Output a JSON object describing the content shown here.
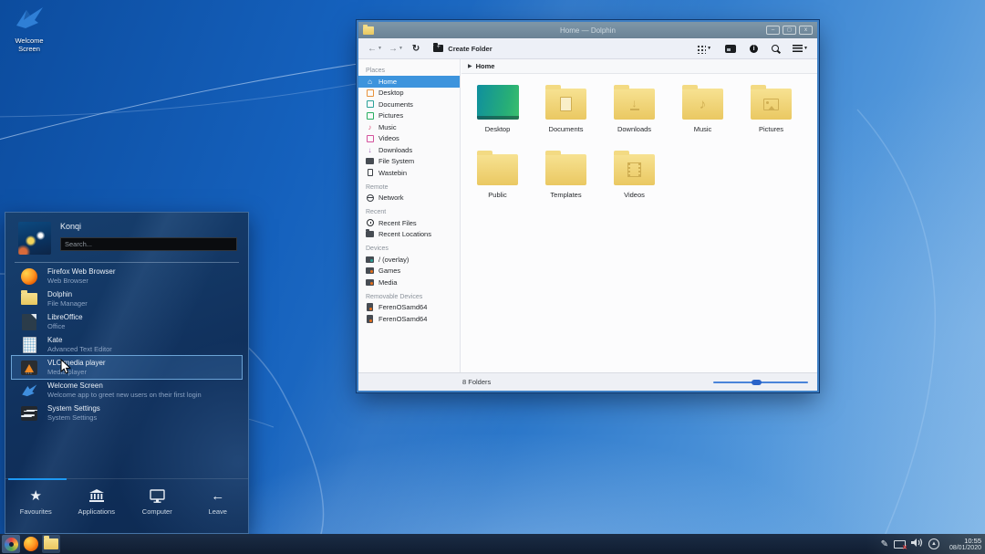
{
  "colors": {
    "accent": "#1d99f3",
    "selection": "#3d94dd",
    "folder": "#eac862",
    "menu_bg": "#10305c",
    "taskbar_bg": "#101d31",
    "titlebar": "#6a8295"
  },
  "desktop": {
    "icon_label": "Welcome\nScreen",
    "icon_label_line1": "Welcome",
    "icon_label_line2": "Screen"
  },
  "window": {
    "title": "Home — Dolphin",
    "buttons": {
      "minimize": "–",
      "maximize": "◻",
      "close": "x"
    },
    "toolbar": {
      "back": "←",
      "forward": "→",
      "refresh": "↻",
      "create_folder_label": "Create Folder"
    },
    "breadcrumb": {
      "caret": "▶",
      "root_label": "Home"
    },
    "places": {
      "sections": [
        {
          "title": "Places",
          "items": [
            {
              "label": "Home"
            },
            {
              "label": "Desktop"
            },
            {
              "label": "Documents"
            },
            {
              "label": "Pictures"
            },
            {
              "label": "Music"
            },
            {
              "label": "Videos"
            },
            {
              "label": "Downloads"
            },
            {
              "label": "File System"
            },
            {
              "label": "Wastebin"
            }
          ]
        },
        {
          "title": "Remote",
          "items": [
            {
              "label": "Network"
            }
          ]
        },
        {
          "title": "Recent",
          "items": [
            {
              "label": "Recent Files"
            },
            {
              "label": "Recent Locations"
            }
          ]
        },
        {
          "title": "Devices",
          "items": [
            {
              "label": "/ (overlay)"
            },
            {
              "label": "Games"
            },
            {
              "label": "Media"
            }
          ]
        },
        {
          "title": "Removable Devices",
          "items": [
            {
              "label": "FerenOSamd64"
            },
            {
              "label": "FerenOSamd64"
            }
          ]
        }
      ]
    },
    "files": [
      {
        "name": "Desktop"
      },
      {
        "name": "Documents"
      },
      {
        "name": "Downloads"
      },
      {
        "name": "Music"
      },
      {
        "name": "Pictures"
      },
      {
        "name": "Public"
      },
      {
        "name": "Templates"
      },
      {
        "name": "Videos"
      }
    ],
    "statusbar": {
      "text": "8 Folders"
    }
  },
  "menu": {
    "user": "Konqi",
    "search_placeholder": "Search...",
    "apps": [
      {
        "name": "Firefox Web Browser",
        "desc": "Web Browser"
      },
      {
        "name": "Dolphin",
        "desc": "File Manager"
      },
      {
        "name": "LibreOffice",
        "desc": "Office"
      },
      {
        "name": "Kate",
        "desc": "Advanced Text Editor"
      },
      {
        "name": "VLC media player",
        "desc": "Media player"
      },
      {
        "name": "Welcome Screen",
        "desc": "Welcome app to greet new users on their first login"
      },
      {
        "name": "System Settings",
        "desc": "System Settings"
      }
    ],
    "tabs": [
      {
        "label": "Favourites",
        "icon": "★"
      },
      {
        "label": "Applications"
      },
      {
        "label": "Computer"
      },
      {
        "label": "Leave",
        "icon": "←"
      }
    ]
  },
  "taskbar": {
    "clock": {
      "time": "10:55",
      "date": "08/01/2020"
    }
  }
}
